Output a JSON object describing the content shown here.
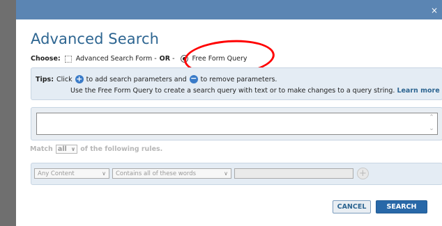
{
  "dialog": {
    "close_glyph": "×",
    "title": "Advanced Search"
  },
  "choose": {
    "label": "Choose:",
    "option_form": "Advanced Search Form -",
    "or_label": "OR",
    "or_dash": "-",
    "option_freeform": "Free Form Query",
    "selected": "Free Form Query"
  },
  "tips": {
    "label": "Tips:",
    "line1_a": "Click",
    "line1_b": "to add search parameters and",
    "line1_c": "to remove parameters.",
    "line2": "Use the Free Form Query to create a search query with text or to make changes to a query string.",
    "learn_more": "Learn more"
  },
  "query": {
    "value": "",
    "scroll_up_glyph": "⌃",
    "scroll_down_glyph": "⌄"
  },
  "match": {
    "prefix": "Match",
    "value": "all",
    "suffix": "of the following rules."
  },
  "rule": {
    "field": "Any Content",
    "operator": "Contains all of these words",
    "text": ""
  },
  "buttons": {
    "cancel": "CANCEL",
    "search": "SEARCH"
  },
  "icons": {
    "plus": "+",
    "minus": "−",
    "chevron": "∨"
  },
  "colors": {
    "titlebar": "#5b85b3",
    "title_text": "#2d6591",
    "primary_button": "#2868a8",
    "annotation": "#ff0000"
  }
}
